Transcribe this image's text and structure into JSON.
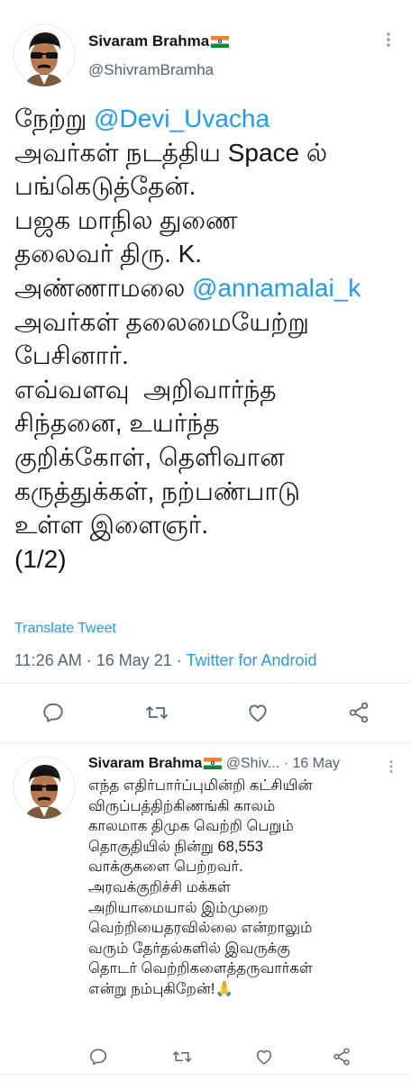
{
  "main_tweet": {
    "author_name": "Sivaram Brahma",
    "handle": "@ShivramBramha",
    "text_lines": [
      {
        "pre": "நேற்று ",
        "mention": "@Devi_Uvacha",
        "post": ""
      },
      {
        "pre": "அவர்கள் நடத்திய Space ல்",
        "mention": "",
        "post": ""
      },
      {
        "pre": "பங்கெடுத்தேன்.",
        "mention": "",
        "post": ""
      },
      {
        "pre": "பஜக மாநில துணை",
        "mention": "",
        "post": ""
      },
      {
        "pre": "தலைவர் திரு. K.",
        "mention": "",
        "post": ""
      },
      {
        "pre": "அண்ணாமலை ",
        "mention": "@annamalai_k",
        "post": ""
      },
      {
        "pre": "அவர்கள் தலைமையேற்று",
        "mention": "",
        "post": ""
      },
      {
        "pre": "பேசினார்.",
        "mention": "",
        "post": ""
      },
      {
        "pre": "எவ்வளவு  அறிவார்ந்த",
        "mention": "",
        "post": ""
      },
      {
        "pre": "சிந்தனை, உயர்ந்த",
        "mention": "",
        "post": ""
      },
      {
        "pre": "குறிக்கோள், தெளிவான",
        "mention": "",
        "post": ""
      },
      {
        "pre": "கருத்துக்கள், நற்பண்பாடு",
        "mention": "",
        "post": ""
      },
      {
        "pre": "உள்ள இளைஞர்.",
        "mention": "",
        "post": ""
      },
      {
        "pre": "(1/2)",
        "mention": "",
        "post": ""
      }
    ],
    "translate_label": "Translate Tweet",
    "time": "11:26 AM",
    "date": "16 May 21",
    "source": "Twitter for Android"
  },
  "reply_tweet": {
    "author_name": "Sivaram Brahma",
    "handle": "@Shiv...",
    "date": "16 May",
    "text": "எந்த எதிர்பார்ப்புமின்றி கட்சியின்\nவிருப்பத்திற்கிணங்கி காலம்\nகாலமாக திமுக வெற்றி பெறும்\nதொகுதியில் நின்று 68,553\nவாக்குகளை பெற்றவர்.\nஅரவக்குறிச்சி மக்கள்\nஅறியாமையால் இம்முறை\nவெற்றியைதரவில்லை என்றாலும்\nவரும் தேர்தல்களில் இவருக்கு\nதொடர் வெற்றிகளைத்தருவார்கள்\nஎன்று நம்புகிறேன்!🙏"
  },
  "icons": {
    "reply": "reply-icon",
    "retweet": "retweet-icon",
    "like": "like-icon",
    "share": "share-icon",
    "more": "more-icon"
  },
  "colors": {
    "link": "#1d9bf0",
    "muted": "#536471",
    "divider": "#e6ecf0"
  }
}
